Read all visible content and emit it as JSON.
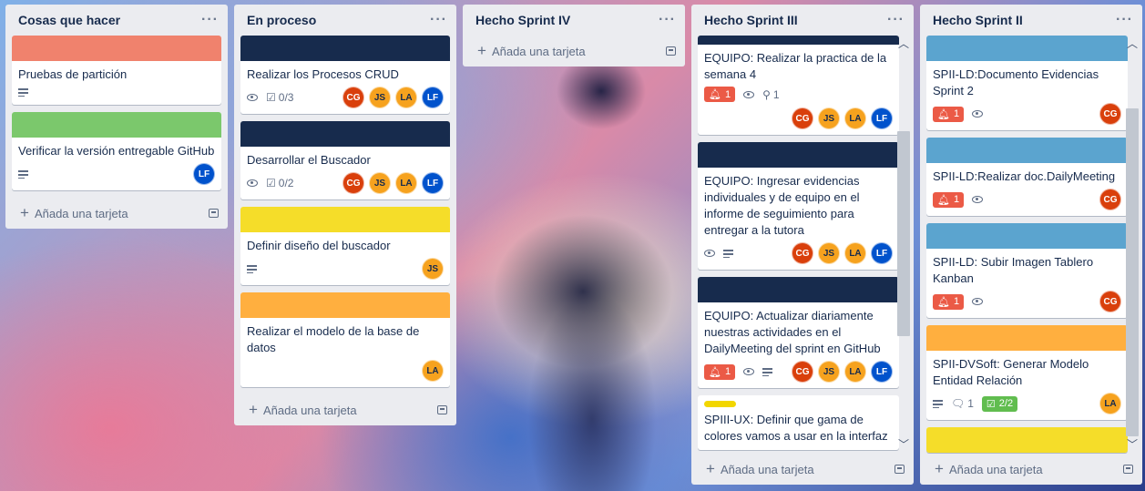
{
  "colors": {
    "red": "#f0826d",
    "green": "#7bc86c",
    "navy": "#172b4d",
    "yellow": "#f5dd29",
    "orange": "#ffaf3f",
    "blue": "#5ba4cf"
  },
  "add_card_label": "Añada una tarjeta",
  "lists": {
    "todo": {
      "title": "Cosas que hacer",
      "cards": [
        {
          "title": "Pruebas de partición"
        },
        {
          "title": "Verificar la versión entregable GitHub",
          "member": "LF"
        }
      ]
    },
    "inprogress": {
      "title": "En proceso",
      "cards": [
        {
          "title": "Realizar los Procesos CRUD",
          "checklist": "0/3",
          "members": [
            "CG",
            "JS",
            "LA",
            "LF"
          ]
        },
        {
          "title": "Desarrollar el Buscador",
          "checklist": "0/2",
          "members": [
            "CG",
            "JS",
            "LA",
            "LF"
          ]
        },
        {
          "title": "Definir diseño del buscador",
          "members": [
            "JS"
          ]
        },
        {
          "title": "Realizar el modelo de la base de datos",
          "members": [
            "LA"
          ]
        }
      ]
    },
    "sprint4": {
      "title": "Hecho Sprint IV"
    },
    "sprint3": {
      "title": "Hecho Sprint III",
      "cards": [
        {
          "title": "EQUIPO: Realizar la practica de la semana 4",
          "notifications": "1",
          "attachments": "1",
          "members": [
            "CG",
            "JS",
            "LA",
            "LF"
          ]
        },
        {
          "title": "EQUIPO: Ingresar evidencias individuales y de equipo en el informe de seguimiento para entregar a la tutora",
          "members": [
            "CG",
            "JS",
            "LA",
            "LF"
          ]
        },
        {
          "title": "EQUIPO: Actualizar diariamente nuestras actividades en el DailyMeeting del sprint en GitHub",
          "notifications": "1",
          "members": [
            "CG",
            "JS",
            "LA",
            "LF"
          ]
        },
        {
          "title": "SPIII-UX: Definir que gama de colores vamos a usar en la interfaz"
        }
      ]
    },
    "sprint2": {
      "title": "Hecho Sprint II",
      "cards": [
        {
          "title": "SPII-LD:Documento Evidencias Sprint 2",
          "notifications": "1",
          "members": [
            "CG"
          ]
        },
        {
          "title": "SPII-LD:Realizar doc.DailyMeeting",
          "notifications": "1",
          "members": [
            "CG"
          ]
        },
        {
          "title": "SPII-LD: Subir Imagen Tablero Kanban",
          "notifications": "1",
          "members": [
            "CG"
          ]
        },
        {
          "title": "SPII-DVSoft: Generar Modelo Entidad Relación",
          "comments": "1",
          "checklist": "2/2",
          "members": [
            "LA"
          ]
        }
      ]
    }
  }
}
